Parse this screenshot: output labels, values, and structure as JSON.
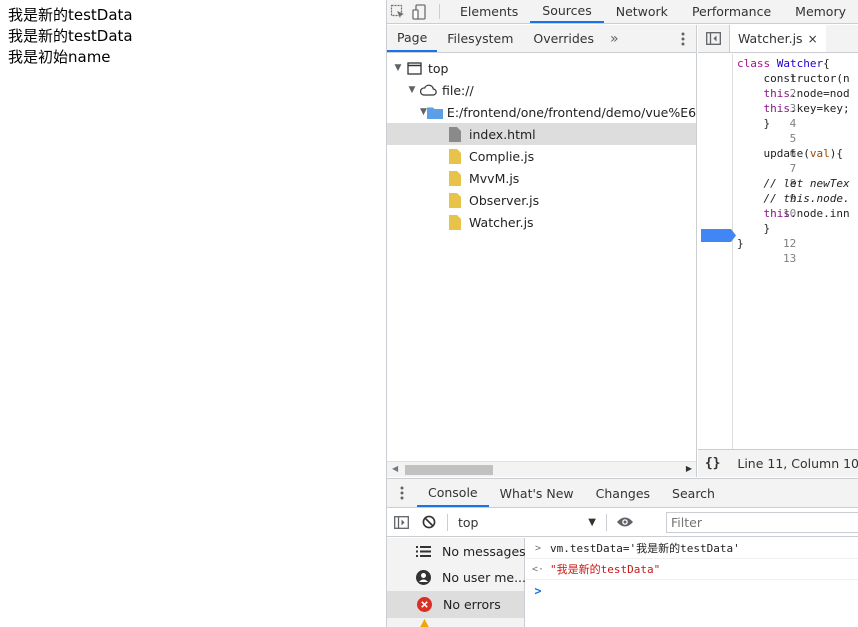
{
  "page": {
    "lines": [
      "我是新的testData",
      "我是新的testData",
      "我是初始name"
    ]
  },
  "devtools": {
    "main_tabs": [
      "Elements",
      "Sources",
      "Network",
      "Performance",
      "Memory"
    ],
    "active_main_tab": "Sources",
    "navigator": {
      "tabs": [
        "Page",
        "Filesystem",
        "Overrides"
      ],
      "more": "»",
      "tree": {
        "top": "top",
        "origin": "file://",
        "folder": "E:/frontend/one/frontend/demo/vue%E6%",
        "files": [
          "index.html",
          "Complie.js",
          "MvvM.js",
          "Observer.js",
          "Watcher.js"
        ],
        "selected_file": "index.html"
      }
    },
    "editor": {
      "tab_label": "Watcher.js",
      "close": "×",
      "status": "Line 11, Column 10",
      "format_icon": "{}",
      "breakpoint_line": 11,
      "lines": [
        {
          "n": "1",
          "t": "class Watcher{"
        },
        {
          "n": "2",
          "t": "    constructor(n"
        },
        {
          "n": "3",
          "t": "    this.node=nod"
        },
        {
          "n": "4",
          "t": "    this.key=key;"
        },
        {
          "n": "5",
          "t": "    }"
        },
        {
          "n": "6",
          "t": ""
        },
        {
          "n": "7",
          "t": "    update(val){"
        },
        {
          "n": "8",
          "t": ""
        },
        {
          "n": "9",
          "t": "    // let newTex"
        },
        {
          "n": "10",
          "t": "    // this.node."
        },
        {
          "n": "11",
          "t": "    this.node.inn"
        },
        {
          "n": "12",
          "t": "    }"
        },
        {
          "n": "13",
          "t": "}"
        }
      ]
    },
    "drawer": {
      "tabs": [
        "Console",
        "What's New",
        "Changes",
        "Search"
      ],
      "active_tab": "Console",
      "context": "top",
      "filter_placeholder": "Filter",
      "sidebar": [
        {
          "label": "No messages",
          "icon": "list-icon"
        },
        {
          "label": "No user me...",
          "icon": "user-icon"
        },
        {
          "label": "No errors",
          "icon": "error-icon"
        }
      ],
      "messages": [
        {
          "prefix": ">",
          "type": "input",
          "text": "vm.testData='我是新的testData'"
        },
        {
          "prefix": "<·",
          "type": "output",
          "text": "\"我是新的testData\""
        }
      ],
      "prompt": ">"
    },
    "colors": {
      "accent": "#1a73e8",
      "breakpoint": "#4285f4",
      "error": "#d93025",
      "folder": "#5c9fe6",
      "js_file": "#e8c34a"
    }
  }
}
